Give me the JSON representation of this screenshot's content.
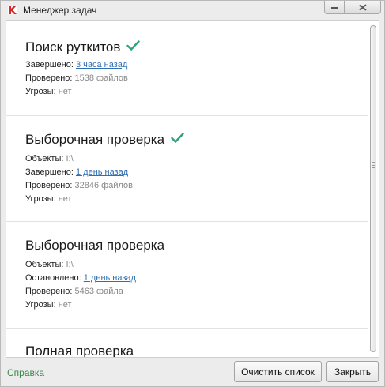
{
  "window": {
    "title": "Менеджер задач"
  },
  "tasks": [
    {
      "title": "Поиск руткитов",
      "completed_ok": true,
      "rows": [
        {
          "label": "Завершено:",
          "value": "3 часа назад",
          "is_link": true
        },
        {
          "label": "Проверено:",
          "value": "1538 файлов",
          "is_link": false
        },
        {
          "label": "Угрозы:",
          "value": "нет",
          "is_link": false
        }
      ]
    },
    {
      "title": "Выборочная проверка",
      "completed_ok": true,
      "rows": [
        {
          "label": "Объекты:",
          "value": "I:\\",
          "is_link": false
        },
        {
          "label": "Завершено:",
          "value": "1 день назад",
          "is_link": true
        },
        {
          "label": "Проверено:",
          "value": "32846 файлов",
          "is_link": false
        },
        {
          "label": "Угрозы:",
          "value": "нет",
          "is_link": false
        }
      ]
    },
    {
      "title": "Выборочная проверка",
      "completed_ok": false,
      "rows": [
        {
          "label": "Объекты:",
          "value": "I:\\",
          "is_link": false
        },
        {
          "label": "Остановлено:",
          "value": "1 день назад",
          "is_link": true
        },
        {
          "label": "Проверено:",
          "value": "5463 файла",
          "is_link": false
        },
        {
          "label": "Угрозы:",
          "value": "нет",
          "is_link": false
        }
      ]
    },
    {
      "title": "Полная проверка",
      "completed_ok": false,
      "rows": []
    }
  ],
  "footer": {
    "help_label": "Справка",
    "clear_label": "Очистить список",
    "close_label": "Закрыть"
  },
  "colors": {
    "check": "#2aa37a",
    "link": "#2f6fb3",
    "help": "#3a8a4a",
    "app_icon": "#d42a2a"
  },
  "icons": {
    "app": "kaspersky-k-icon",
    "minimize": "minimize-icon",
    "close": "close-icon",
    "check": "checkmark-icon"
  }
}
